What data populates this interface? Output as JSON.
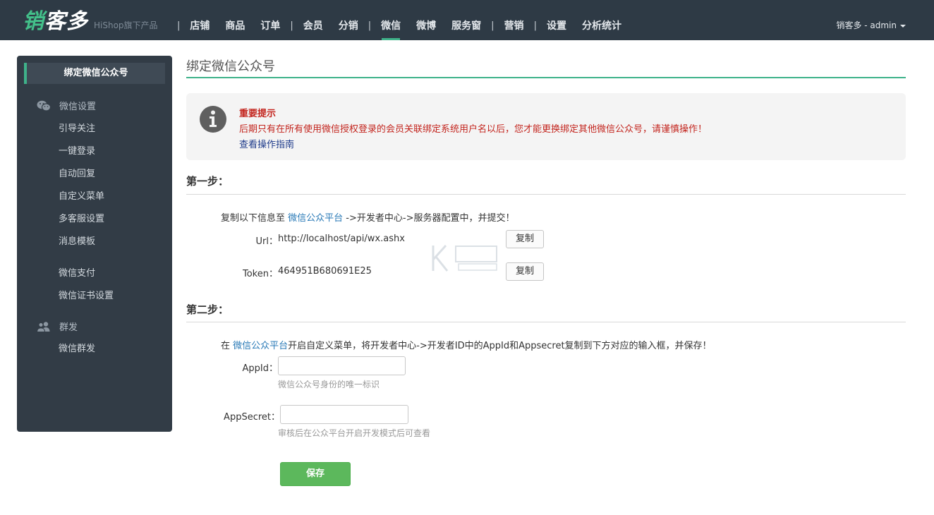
{
  "header": {
    "logo_main": "销客多",
    "logo_sub": "HiShop旗下产品",
    "nav": [
      {
        "label": "店铺"
      },
      {
        "label": "商品"
      },
      {
        "label": "订单"
      },
      {
        "label": "会员"
      },
      {
        "label": "分销"
      },
      {
        "label": "微信",
        "active": true
      },
      {
        "label": "微博"
      },
      {
        "label": "服务窗"
      },
      {
        "label": "营销"
      },
      {
        "label": "设置"
      },
      {
        "label": "分析统计"
      }
    ],
    "separator": "|",
    "user_menu": "销客多 - admin"
  },
  "sidebar": {
    "active_item": "绑定微信公众号",
    "groups": [
      {
        "label": "微信设置",
        "icon": "wechat-icon",
        "items": [
          "引导关注",
          "一键登录",
          "自动回复",
          "自定义菜单",
          "多客服设置",
          "消息模板",
          "微信支付",
          "微信证书设置"
        ]
      },
      {
        "label": "群发",
        "icon": "users-icon",
        "items": [
          "微信群发"
        ]
      }
    ]
  },
  "main": {
    "page_title": "绑定微信公众号",
    "notice": {
      "title": "重要提示",
      "text": "后期只有在所有使用微信授权登录的会员关联绑定系统用户名以后，您才能更换绑定其他微信公众号，请谨慎操作！",
      "link": "查看操作指南"
    },
    "step1": {
      "title": "第一步：",
      "desc_prefix": "复制以下信息至 ",
      "desc_link": "微信公众平台",
      "desc_suffix": " ->开发者中心->服务器配置中，并提交！",
      "url_label": "Url：",
      "url_value": "http://localhost/api/wx.ashx",
      "token_label": "Token：",
      "token_value": "464951B680691E25",
      "copy_label": "复制"
    },
    "step2": {
      "title": "第二步：",
      "desc_prefix": "在 ",
      "desc_link": "微信公众平台",
      "desc_suffix": "开启自定义菜单，将开发者中心->开发者ID中的AppId和Appsecret复制到下方对应的输入框，并保存！",
      "appid_label": "AppId：",
      "appid_value": "",
      "appid_hint": "微信公众号身份的唯一标识",
      "appsecret_label": "AppSecret：",
      "appsecret_value": "",
      "appsecret_hint": "审核后在公众平台开启开发模式后可查看"
    },
    "save_label": "保存"
  },
  "colors": {
    "topbar_bg": "#2e3a45",
    "accent": "#3fb28a",
    "sidebar_bg": "#323c46",
    "warning_text": "#c3251e",
    "link": "#2a7ab7",
    "save_button": "#5cb85c"
  }
}
